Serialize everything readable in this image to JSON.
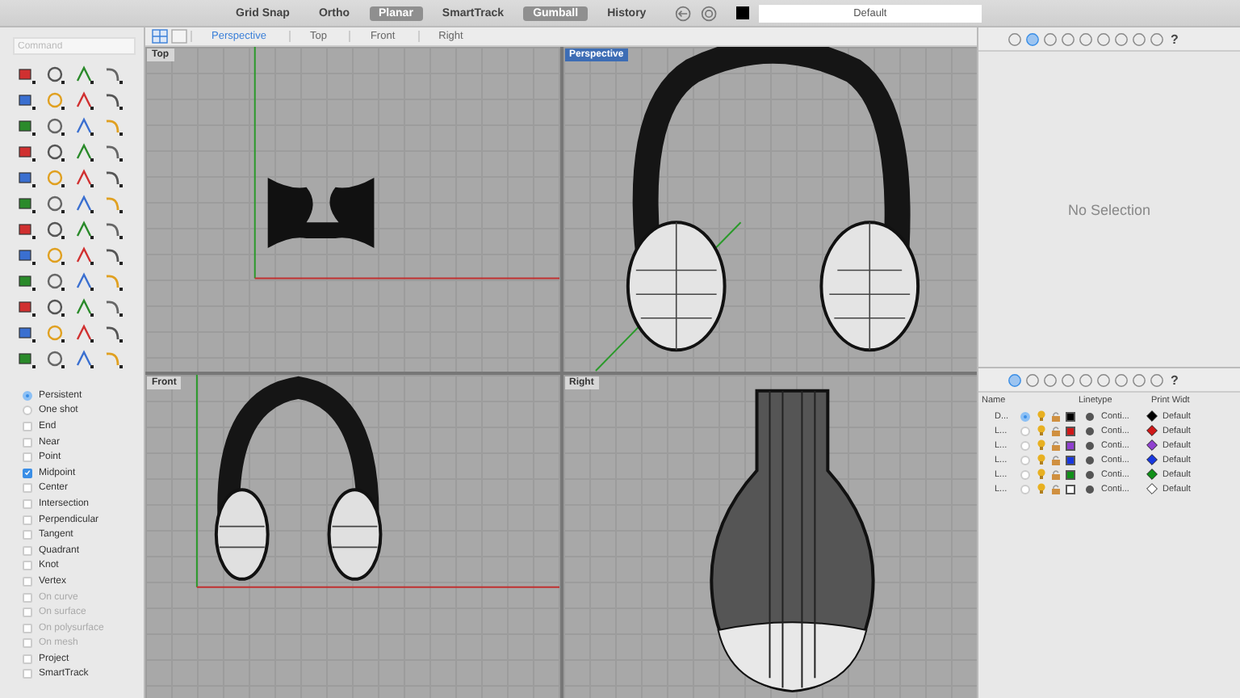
{
  "status_bar": {
    "toggles": [
      {
        "label": "Grid Snap",
        "on": false
      },
      {
        "label": "Ortho",
        "on": false
      },
      {
        "label": "Planar",
        "on": true
      },
      {
        "label": "SmartTrack",
        "on": false
      },
      {
        "label": "Gumball",
        "on": true
      },
      {
        "label": "History",
        "on": false
      }
    ],
    "material": "Default"
  },
  "viewport_tabs": [
    {
      "label": "Perspective",
      "selected": true
    },
    {
      "label": "Top",
      "selected": false
    },
    {
      "label": "Front",
      "selected": false
    },
    {
      "label": "Right",
      "selected": false
    }
  ],
  "command": {
    "placeholder": "Command"
  },
  "osnaps": [
    {
      "kind": "radio",
      "label": "Persistent",
      "selected": true
    },
    {
      "kind": "radio",
      "label": "One shot",
      "selected": false
    },
    {
      "kind": "checkbox",
      "label": "End",
      "checked": false,
      "disabled": false
    },
    {
      "kind": "checkbox",
      "label": "Near",
      "checked": false,
      "disabled": false
    },
    {
      "kind": "checkbox",
      "label": "Point",
      "checked": false,
      "disabled": false
    },
    {
      "kind": "checkbox",
      "label": "Midpoint",
      "checked": true,
      "disabled": false
    },
    {
      "kind": "checkbox",
      "label": "Center",
      "checked": false,
      "disabled": false
    },
    {
      "kind": "checkbox",
      "label": "Intersection",
      "checked": false,
      "disabled": false
    },
    {
      "kind": "checkbox",
      "label": "Perpendicular",
      "checked": false,
      "disabled": false
    },
    {
      "kind": "checkbox",
      "label": "Tangent",
      "checked": false,
      "disabled": false
    },
    {
      "kind": "checkbox",
      "label": "Quadrant",
      "checked": false,
      "disabled": false
    },
    {
      "kind": "checkbox",
      "label": "Knot",
      "checked": false,
      "disabled": false
    },
    {
      "kind": "checkbox",
      "label": "Vertex",
      "checked": false,
      "disabled": false
    },
    {
      "kind": "checkbox",
      "label": "On curve",
      "checked": false,
      "disabled": true
    },
    {
      "kind": "checkbox",
      "label": "On surface",
      "checked": false,
      "disabled": true
    },
    {
      "kind": "checkbox",
      "label": "On polysurface",
      "checked": false,
      "disabled": true
    },
    {
      "kind": "checkbox",
      "label": "On mesh",
      "checked": false,
      "disabled": true
    },
    {
      "kind": "checkbox",
      "label": "Project",
      "checked": false,
      "disabled": false
    },
    {
      "kind": "checkbox",
      "label": "SmartTrack",
      "checked": false,
      "disabled": false
    }
  ],
  "viewports": [
    {
      "label": "Top",
      "selected": false,
      "kind": "top"
    },
    {
      "label": "Perspective",
      "selected": true,
      "kind": "perspective"
    },
    {
      "label": "Front",
      "selected": false,
      "kind": "front"
    },
    {
      "label": "Right",
      "selected": false,
      "kind": "right"
    }
  ],
  "properties_panel": {
    "tabs": [
      {
        "selected": false
      },
      {
        "selected": true
      },
      {
        "selected": false
      },
      {
        "selected": false
      },
      {
        "selected": false
      },
      {
        "selected": false
      },
      {
        "selected": false
      },
      {
        "selected": false
      },
      {
        "selected": false
      }
    ],
    "help": "?",
    "message": "No Selection"
  },
  "layers_panel": {
    "tabs": [
      {
        "selected": true
      },
      {
        "selected": false
      },
      {
        "selected": false
      },
      {
        "selected": false
      },
      {
        "selected": false
      },
      {
        "selected": false
      },
      {
        "selected": false
      },
      {
        "selected": false
      },
      {
        "selected": false
      }
    ],
    "help": "?",
    "columns": [
      "Name",
      "Linetype",
      "Print Widt"
    ],
    "rows": [
      {
        "name": "D...",
        "current": true,
        "color": "#000000",
        "linetype": "Conti...",
        "print_width": "Default"
      },
      {
        "name": "L...",
        "current": false,
        "color": "#d01818",
        "linetype": "Conti...",
        "print_width": "Default"
      },
      {
        "name": "L...",
        "current": false,
        "color": "#9040d0",
        "linetype": "Conti...",
        "print_width": "Default"
      },
      {
        "name": "L...",
        "current": false,
        "color": "#1838e0",
        "linetype": "Conti...",
        "print_width": "Default"
      },
      {
        "name": "L...",
        "current": false,
        "color": "#109018",
        "linetype": "Conti...",
        "print_width": "Default"
      },
      {
        "name": "L...",
        "current": false,
        "color": "#ffffff",
        "linetype": "Conti...",
        "print_width": "Default"
      }
    ]
  }
}
